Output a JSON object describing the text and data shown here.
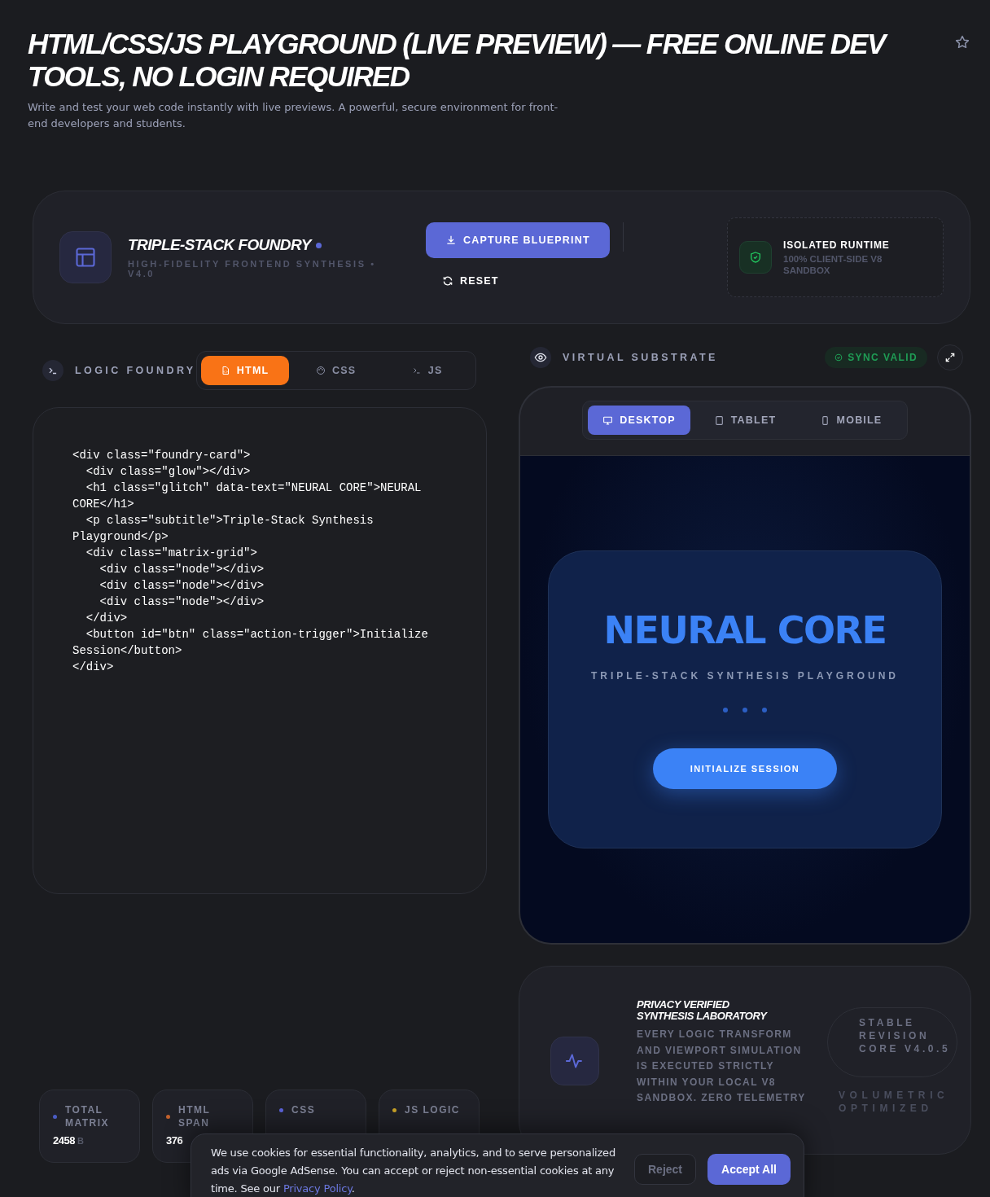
{
  "header": {
    "title": "HTML/CSS/JS PLAYGROUND (LIVE PREVIEW) — FREE ONLINE DEV TOOLS, NO LOGIN REQUIRED",
    "subtitle": "Write and test your web code instantly with live previews. A powerful, secure environment for front-end developers and students."
  },
  "toolbar": {
    "title": "TRIPLE-STACK FOUNDRY",
    "subtitle": "HIGH-FIDELITY FRONTEND SYNTHESIS • V4.0",
    "buttons": [
      {
        "label": "CAPTURE BLUEPRINT",
        "kind": "primary"
      },
      {
        "label": "RESET",
        "kind": "plain"
      }
    ],
    "runtime": {
      "title": "ISOLATED RUNTIME",
      "subtitle": "100% CLIENT-SIDE V8 SANDBOX"
    }
  },
  "editor": {
    "title": "LOGIC FOUNDRY",
    "tabs": [
      {
        "label": "HTML",
        "selected": true
      },
      {
        "label": "CSS",
        "selected": false
      },
      {
        "label": "JS",
        "selected": false
      }
    ],
    "code": "<div class=\"foundry-card\">\n  <div class=\"glow\"></div>\n  <h1 class=\"glitch\" data-text=\"NEURAL CORE\">NEURAL CORE</h1>\n  <p class=\"subtitle\">Triple-Stack Synthesis Playground</p>\n  <div class=\"matrix-grid\">\n    <div class=\"node\"></div>\n    <div class=\"node\"></div>\n    <div class=\"node\"></div>\n  </div>\n  <button id=\"btn\" class=\"action-trigger\">Initialize Session</button>\n</div>"
  },
  "preview": {
    "title": "VIRTUAL SUBSTRATE",
    "status": "SYNC VALID",
    "devices": [
      {
        "label": "DESKTOP",
        "selected": true
      },
      {
        "label": "TABLET",
        "selected": false
      },
      {
        "label": "MOBILE",
        "selected": false
      }
    ],
    "content": {
      "heading": "NEURAL CORE",
      "tagline": "TRIPLE-STACK SYNTHESIS PLAYGROUND",
      "button": "INITIALIZE SESSION"
    }
  },
  "stats": [
    {
      "label": "TOTAL MATRIX",
      "value": "2458",
      "unit": "B",
      "color": "#4a5cc4"
    },
    {
      "label": "HTML SPAN",
      "value": "376",
      "color": "#c2612c"
    },
    {
      "label": "CSS",
      "color": "#5b63d8"
    },
    {
      "label": "JS LOGIC",
      "color": "#c9a227"
    }
  ],
  "privacy": {
    "title": "PRIVACY VERIFIED SYNTHESIS LABORATORY",
    "text": "EVERY LOGIC TRANSFORM AND VIEWPORT SIMULATION IS EXECUTED STRICTLY WITHIN YOUR LOCAL V8 SANDBOX. ZERO TELEMETRY",
    "revision": "STABLE REVISION CORE V4.0.5",
    "note": "VOLUMETRIC OPTIMIZED"
  },
  "cookie": {
    "text": "We use cookies for essential functionality, analytics, and to serve personalized ads via Google AdSense. You can accept or reject non-essential cookies at any time. See our",
    "link": "Privacy Policy",
    "end": ".",
    "buttons": [
      {
        "label": "Reject",
        "kind": "secondary"
      },
      {
        "label": "Accept All",
        "kind": "primary"
      }
    ]
  }
}
